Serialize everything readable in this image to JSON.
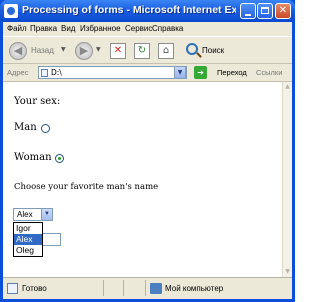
{
  "window": {
    "title": "Processing of forms - Microsoft Internet Explorer"
  },
  "menu": [
    "Файл",
    "Правка",
    "Вид",
    "Избранное",
    "Сервис",
    "Справка"
  ],
  "toolbar": {
    "back_label": "Назад",
    "search_label": "Поиск"
  },
  "address": {
    "label": "Адрес",
    "value": "D:\\",
    "go_label": "Переход",
    "links_label": "Ссылки"
  },
  "form": {
    "sex_label": "Your sex:",
    "man_label": "Man",
    "woman_label": "Woman",
    "man_checked": false,
    "woman_checked": true,
    "favorite_label": "Choose your favorite man's name",
    "select_value": "Alex",
    "options": [
      "Igor",
      "Alex",
      "Oleg"
    ],
    "highlighted_option": "Alex"
  },
  "status": {
    "left_text": "Готово",
    "zone_text": "Мой компьютер"
  }
}
